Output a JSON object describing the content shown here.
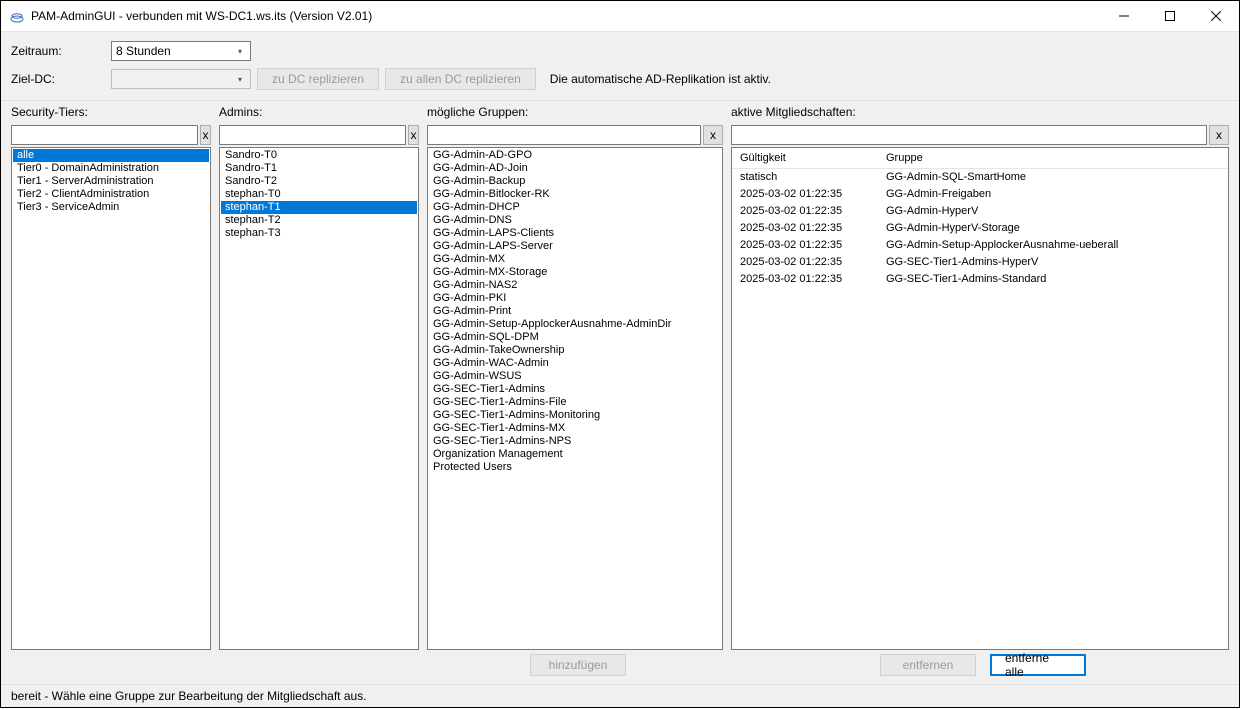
{
  "window": {
    "title": "PAM-AdminGUI - verbunden mit WS-DC1.ws.its (Version V2.01)"
  },
  "toolbar": {
    "zeitraum_label": "Zeitraum:",
    "zeitraum_value": "8 Stunden",
    "zieldc_label": "Ziel-DC:",
    "zieldc_value": "",
    "btn_replicate": "zu DC replizieren",
    "btn_replicate_all": "zu allen DC replizieren",
    "auto_repl_text": "Die automatische AD-Replikation ist aktiv."
  },
  "columns": {
    "tiers_label": "Security-Tiers:",
    "admins_label": "Admins:",
    "groups_label": "mögliche Gruppen:",
    "members_label": "aktive Mitgliedschaften:",
    "clear_label": "x"
  },
  "tiers": {
    "selected_index": 0,
    "items": [
      "alle",
      "Tier0 - DomainAdministration",
      "Tier1 - ServerAdministration",
      "Tier2 - ClientAdministration",
      "Tier3 - ServiceAdmin"
    ]
  },
  "admins": {
    "selected_index": 4,
    "items": [
      "Sandro-T0",
      "Sandro-T1",
      "Sandro-T2",
      "stephan-T0",
      "stephan-T1",
      "stephan-T2",
      "stephan-T3"
    ]
  },
  "groups": {
    "items": [
      "GG-Admin-AD-GPO",
      "GG-Admin-AD-Join",
      "GG-Admin-Backup",
      "GG-Admin-Bitlocker-RK",
      "GG-Admin-DHCP",
      "GG-Admin-DNS",
      "GG-Admin-LAPS-Clients",
      "GG-Admin-LAPS-Server",
      "GG-Admin-MX",
      "GG-Admin-MX-Storage",
      "GG-Admin-NAS2",
      "GG-Admin-PKI",
      "GG-Admin-Print",
      "GG-Admin-Setup-ApplockerAusnahme-AdminDir",
      "GG-Admin-SQL-DPM",
      "GG-Admin-TakeOwnership",
      "GG-Admin-WAC-Admin",
      "GG-Admin-WSUS",
      "GG-SEC-Tier1-Admins",
      "GG-SEC-Tier1-Admins-File",
      "GG-SEC-Tier1-Admins-Monitoring",
      "GG-SEC-Tier1-Admins-MX",
      "GG-SEC-Tier1-Admins-NPS",
      "Organization Management",
      "Protected Users"
    ]
  },
  "memberships": {
    "col_validity": "Gültigkeit",
    "col_group": "Gruppe",
    "rows": [
      {
        "validity": "statisch",
        "group": "GG-Admin-SQL-SmartHome"
      },
      {
        "validity": "2025-03-02 01:22:35",
        "group": "GG-Admin-Freigaben"
      },
      {
        "validity": "2025-03-02 01:22:35",
        "group": "GG-Admin-HyperV"
      },
      {
        "validity": "2025-03-02 01:22:35",
        "group": "GG-Admin-HyperV-Storage"
      },
      {
        "validity": "2025-03-02 01:22:35",
        "group": "GG-Admin-Setup-ApplockerAusnahme-ueberall"
      },
      {
        "validity": "2025-03-02 01:22:35",
        "group": "GG-SEC-Tier1-Admins-HyperV"
      },
      {
        "validity": "2025-03-02 01:22:35",
        "group": "GG-SEC-Tier1-Admins-Standard"
      }
    ]
  },
  "footer": {
    "btn_add": "hinzufügen",
    "btn_remove": "entfernen",
    "btn_remove_all": "entferne alle"
  },
  "statusbar": {
    "text": "bereit - Wähle eine Gruppe zur Bearbeitung der Mitgliedschaft aus."
  }
}
